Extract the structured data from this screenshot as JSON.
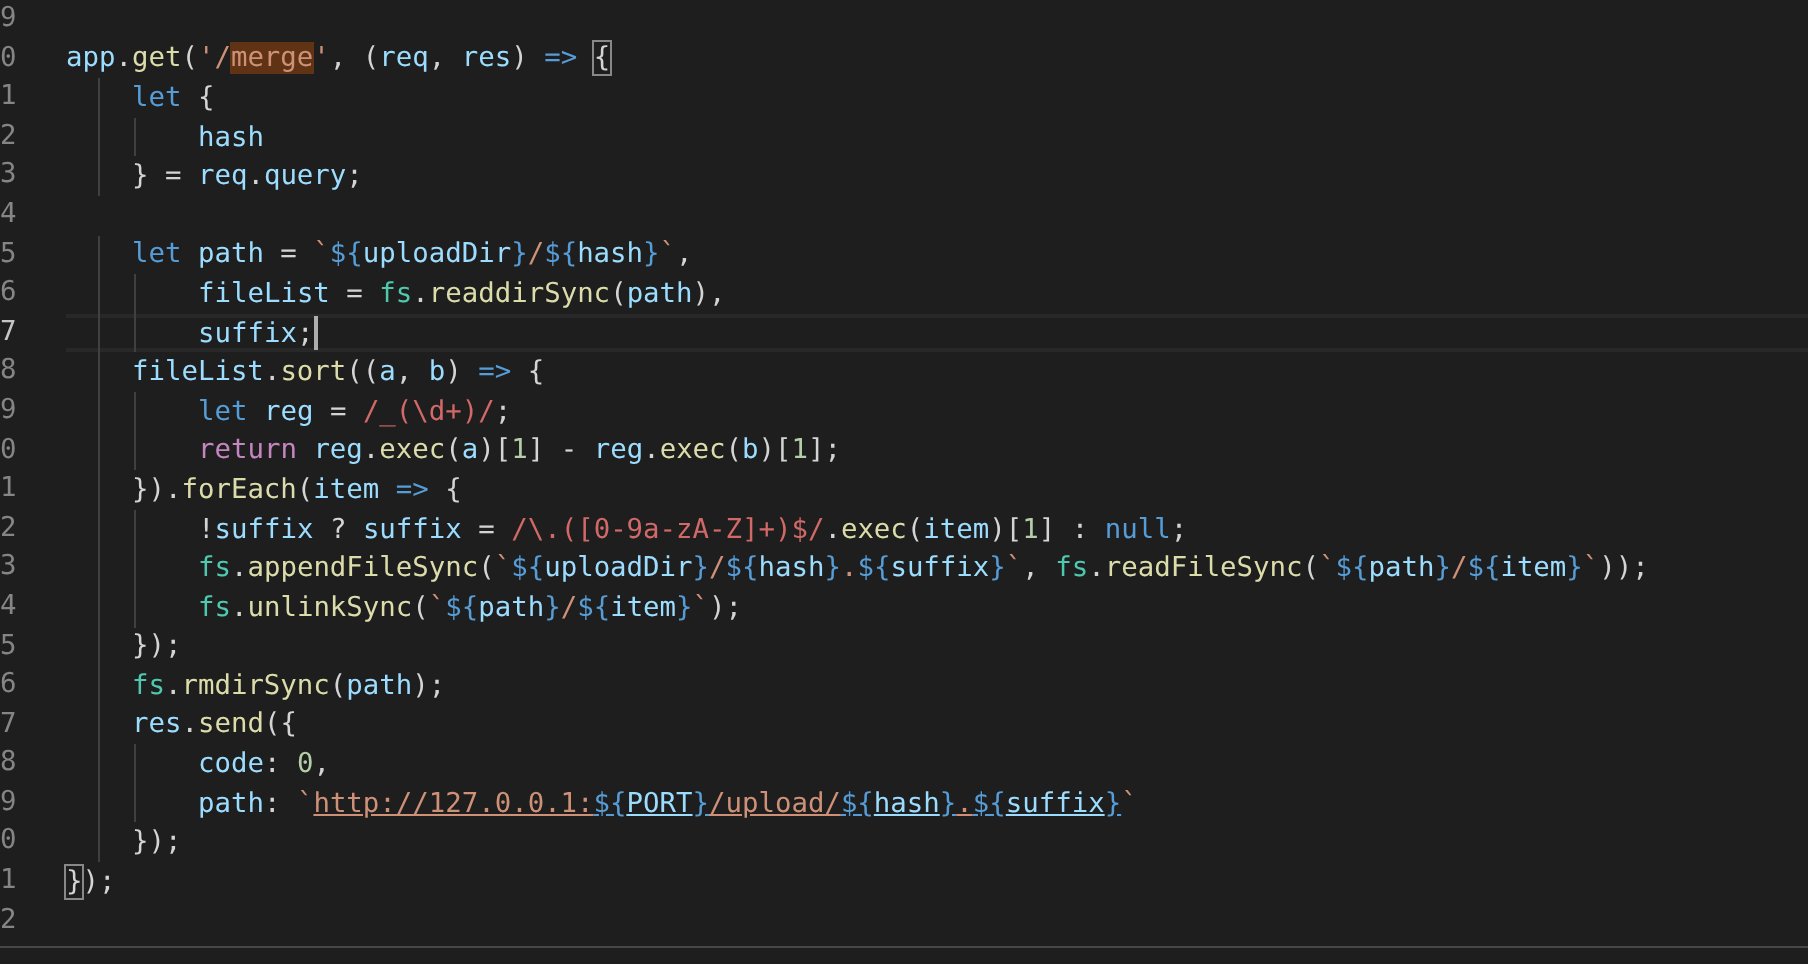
{
  "editor": {
    "lines": [
      {
        "number": "9",
        "current": false
      },
      {
        "number": "0",
        "current": false,
        "tokens": [
          {
            "kind": "variable",
            "text": "app"
          },
          {
            "kind": "punct",
            "text": "."
          },
          {
            "kind": "function",
            "text": "get"
          },
          {
            "kind": "punct",
            "text": "("
          },
          {
            "kind": "string",
            "text": "'/"
          },
          {
            "kind": "string",
            "text": "merge",
            "find_match": true
          },
          {
            "kind": "string",
            "text": "'"
          },
          {
            "kind": "punct",
            "text": ", ("
          },
          {
            "kind": "variable",
            "text": "req"
          },
          {
            "kind": "punct",
            "text": ", "
          },
          {
            "kind": "variable",
            "text": "res"
          },
          {
            "kind": "punct",
            "text": ") "
          },
          {
            "kind": "keyword",
            "text": "=> "
          },
          {
            "kind": "punct",
            "text": "{",
            "bracket_match": true
          }
        ]
      },
      {
        "number": "1",
        "current": false,
        "tokens": [
          {
            "kind": "keyword",
            "text": "    let"
          },
          {
            "kind": "punct",
            "text": " {"
          }
        ]
      },
      {
        "number": "2",
        "current": false,
        "tokens": [
          {
            "kind": "variable",
            "text": "        hash"
          }
        ]
      },
      {
        "number": "3",
        "current": false,
        "tokens": [
          {
            "kind": "punct",
            "text": "    } = "
          },
          {
            "kind": "variable",
            "text": "req"
          },
          {
            "kind": "punct",
            "text": "."
          },
          {
            "kind": "variable",
            "text": "query"
          },
          {
            "kind": "punct",
            "text": ";"
          }
        ]
      },
      {
        "number": "4",
        "current": false
      },
      {
        "number": "5",
        "current": false,
        "tokens": [
          {
            "kind": "keyword",
            "text": "    let "
          },
          {
            "kind": "variable",
            "text": "path"
          },
          {
            "kind": "punct",
            "text": " = "
          },
          {
            "kind": "string",
            "text": "`"
          },
          {
            "kind": "template",
            "text": "${"
          },
          {
            "kind": "variable",
            "text": "uploadDir"
          },
          {
            "kind": "template",
            "text": "}"
          },
          {
            "kind": "string",
            "text": "/"
          },
          {
            "kind": "template",
            "text": "${"
          },
          {
            "kind": "variable",
            "text": "hash"
          },
          {
            "kind": "template",
            "text": "}"
          },
          {
            "kind": "string",
            "text": "`"
          },
          {
            "kind": "punct",
            "text": ","
          }
        ]
      },
      {
        "number": "6",
        "current": false,
        "tokens": [
          {
            "kind": "variable",
            "text": "        fileList"
          },
          {
            "kind": "punct",
            "text": " = "
          },
          {
            "kind": "type",
            "text": "fs"
          },
          {
            "kind": "punct",
            "text": "."
          },
          {
            "kind": "function",
            "text": "readdirSync"
          },
          {
            "kind": "punct",
            "text": "("
          },
          {
            "kind": "variable",
            "text": "path"
          },
          {
            "kind": "punct",
            "text": "),"
          }
        ]
      },
      {
        "number": "7",
        "current": true,
        "tokens": [
          {
            "kind": "variable",
            "text": "        suffix"
          },
          {
            "kind": "punct",
            "text": ";"
          }
        ]
      },
      {
        "number": "8",
        "current": false,
        "tokens": [
          {
            "kind": "variable",
            "text": "    fileList"
          },
          {
            "kind": "punct",
            "text": "."
          },
          {
            "kind": "function",
            "text": "sort"
          },
          {
            "kind": "punct",
            "text": "(("
          },
          {
            "kind": "variable",
            "text": "a"
          },
          {
            "kind": "punct",
            "text": ", "
          },
          {
            "kind": "variable",
            "text": "b"
          },
          {
            "kind": "punct",
            "text": ") "
          },
          {
            "kind": "keyword",
            "text": "=>"
          },
          {
            "kind": "punct",
            "text": " {"
          }
        ]
      },
      {
        "number": "9",
        "current": false,
        "tokens": [
          {
            "kind": "keyword",
            "text": "        let "
          },
          {
            "kind": "variable",
            "text": "reg"
          },
          {
            "kind": "punct",
            "text": " = "
          },
          {
            "kind": "regex",
            "text": "/_(\\d+)/"
          },
          {
            "kind": "punct",
            "text": ";"
          }
        ]
      },
      {
        "number": "0",
        "current": false,
        "tokens": [
          {
            "kind": "control",
            "text": "        return "
          },
          {
            "kind": "variable",
            "text": "reg"
          },
          {
            "kind": "punct",
            "text": "."
          },
          {
            "kind": "function",
            "text": "exec"
          },
          {
            "kind": "punct",
            "text": "("
          },
          {
            "kind": "variable",
            "text": "a"
          },
          {
            "kind": "punct",
            "text": ")["
          },
          {
            "kind": "number",
            "text": "1"
          },
          {
            "kind": "punct",
            "text": "] - "
          },
          {
            "kind": "variable",
            "text": "reg"
          },
          {
            "kind": "punct",
            "text": "."
          },
          {
            "kind": "function",
            "text": "exec"
          },
          {
            "kind": "punct",
            "text": "("
          },
          {
            "kind": "variable",
            "text": "b"
          },
          {
            "kind": "punct",
            "text": ")["
          },
          {
            "kind": "number",
            "text": "1"
          },
          {
            "kind": "punct",
            "text": "];"
          }
        ]
      },
      {
        "number": "1",
        "current": false,
        "tokens": [
          {
            "kind": "punct",
            "text": "    })."
          },
          {
            "kind": "function",
            "text": "forEach"
          },
          {
            "kind": "punct",
            "text": "("
          },
          {
            "kind": "variable",
            "text": "item"
          },
          {
            "kind": "keyword",
            "text": " =>"
          },
          {
            "kind": "punct",
            "text": " {"
          }
        ]
      },
      {
        "number": "2",
        "current": false,
        "tokens": [
          {
            "kind": "punct",
            "text": "        !"
          },
          {
            "kind": "variable",
            "text": "suffix"
          },
          {
            "kind": "punct",
            "text": " ? "
          },
          {
            "kind": "variable",
            "text": "suffix"
          },
          {
            "kind": "punct",
            "text": " = "
          },
          {
            "kind": "regex",
            "text": "/\\.([0-9a-zA-Z]+)$/"
          },
          {
            "kind": "punct",
            "text": "."
          },
          {
            "kind": "function",
            "text": "exec"
          },
          {
            "kind": "punct",
            "text": "("
          },
          {
            "kind": "variable",
            "text": "item"
          },
          {
            "kind": "punct",
            "text": ")["
          },
          {
            "kind": "number",
            "text": "1"
          },
          {
            "kind": "punct",
            "text": "] : "
          },
          {
            "kind": "keyword",
            "text": "null"
          },
          {
            "kind": "punct",
            "text": ";"
          }
        ]
      },
      {
        "number": "3",
        "current": false,
        "tokens": [
          {
            "kind": "type",
            "text": "        fs"
          },
          {
            "kind": "punct",
            "text": "."
          },
          {
            "kind": "function",
            "text": "appendFileSync"
          },
          {
            "kind": "punct",
            "text": "("
          },
          {
            "kind": "string",
            "text": "`"
          },
          {
            "kind": "template",
            "text": "${"
          },
          {
            "kind": "variable",
            "text": "uploadDir"
          },
          {
            "kind": "template",
            "text": "}"
          },
          {
            "kind": "string",
            "text": "/"
          },
          {
            "kind": "template",
            "text": "${"
          },
          {
            "kind": "variable",
            "text": "hash"
          },
          {
            "kind": "template",
            "text": "}"
          },
          {
            "kind": "string",
            "text": "."
          },
          {
            "kind": "template",
            "text": "${"
          },
          {
            "kind": "variable",
            "text": "suffix"
          },
          {
            "kind": "template",
            "text": "}"
          },
          {
            "kind": "string",
            "text": "`"
          },
          {
            "kind": "punct",
            "text": ", "
          },
          {
            "kind": "type",
            "text": "fs"
          },
          {
            "kind": "punct",
            "text": "."
          },
          {
            "kind": "function",
            "text": "readFileSync"
          },
          {
            "kind": "punct",
            "text": "("
          },
          {
            "kind": "string",
            "text": "`"
          },
          {
            "kind": "template",
            "text": "${"
          },
          {
            "kind": "variable",
            "text": "path"
          },
          {
            "kind": "template",
            "text": "}"
          },
          {
            "kind": "string",
            "text": "/"
          },
          {
            "kind": "template",
            "text": "${"
          },
          {
            "kind": "variable",
            "text": "item"
          },
          {
            "kind": "template",
            "text": "}"
          },
          {
            "kind": "string",
            "text": "`"
          },
          {
            "kind": "punct",
            "text": "));"
          }
        ]
      },
      {
        "number": "4",
        "current": false,
        "tokens": [
          {
            "kind": "type",
            "text": "        fs"
          },
          {
            "kind": "punct",
            "text": "."
          },
          {
            "kind": "function",
            "text": "unlinkSync"
          },
          {
            "kind": "punct",
            "text": "("
          },
          {
            "kind": "string",
            "text": "`"
          },
          {
            "kind": "template",
            "text": "${"
          },
          {
            "kind": "variable",
            "text": "path"
          },
          {
            "kind": "template",
            "text": "}"
          },
          {
            "kind": "string",
            "text": "/"
          },
          {
            "kind": "template",
            "text": "${"
          },
          {
            "kind": "variable",
            "text": "item"
          },
          {
            "kind": "template",
            "text": "}"
          },
          {
            "kind": "string",
            "text": "`"
          },
          {
            "kind": "punct",
            "text": ");"
          }
        ]
      },
      {
        "number": "5",
        "current": false,
        "tokens": [
          {
            "kind": "punct",
            "text": "    });"
          }
        ]
      },
      {
        "number": "6",
        "current": false,
        "tokens": [
          {
            "kind": "type",
            "text": "    fs"
          },
          {
            "kind": "punct",
            "text": "."
          },
          {
            "kind": "function",
            "text": "rmdirSync"
          },
          {
            "kind": "punct",
            "text": "("
          },
          {
            "kind": "variable",
            "text": "path"
          },
          {
            "kind": "punct",
            "text": ");"
          }
        ]
      },
      {
        "number": "7",
        "current": false,
        "tokens": [
          {
            "kind": "variable",
            "text": "    res"
          },
          {
            "kind": "punct",
            "text": "."
          },
          {
            "kind": "function",
            "text": "send"
          },
          {
            "kind": "punct",
            "text": "({"
          }
        ]
      },
      {
        "number": "8",
        "current": false,
        "tokens": [
          {
            "kind": "variable",
            "text": "        code"
          },
          {
            "kind": "punct",
            "text": ": "
          },
          {
            "kind": "number",
            "text": "0"
          },
          {
            "kind": "punct",
            "text": ","
          }
        ]
      },
      {
        "number": "9",
        "current": false,
        "tokens": [
          {
            "kind": "variable",
            "text": "        path"
          },
          {
            "kind": "punct",
            "text": ": "
          },
          {
            "kind": "string",
            "text": "`"
          },
          {
            "kind": "string",
            "text": "http://127.0.0.1:",
            "link": true
          },
          {
            "kind": "template",
            "text": "${",
            "link": true
          },
          {
            "kind": "variable",
            "text": "PORT",
            "link": true
          },
          {
            "kind": "template",
            "text": "}",
            "link": true
          },
          {
            "kind": "string",
            "text": "/upload/",
            "link": true
          },
          {
            "kind": "template",
            "text": "${",
            "link": true
          },
          {
            "kind": "variable",
            "text": "hash",
            "link": true
          },
          {
            "kind": "template",
            "text": "}",
            "link": true
          },
          {
            "kind": "string",
            "text": ".",
            "link": true
          },
          {
            "kind": "template",
            "text": "${",
            "link": true
          },
          {
            "kind": "variable",
            "text": "suffix",
            "link": true
          },
          {
            "kind": "template",
            "text": "}",
            "link": true
          },
          {
            "kind": "string",
            "text": "`"
          }
        ]
      },
      {
        "number": "0",
        "current": false,
        "tokens": [
          {
            "kind": "punct",
            "text": "    });"
          }
        ]
      },
      {
        "number": "1",
        "current": false,
        "tokens": [
          {
            "kind": "punct",
            "text": "}",
            "bracket_match": true
          },
          {
            "kind": "punct",
            "text": ");"
          }
        ]
      },
      {
        "number": "2",
        "current": false
      }
    ]
  }
}
